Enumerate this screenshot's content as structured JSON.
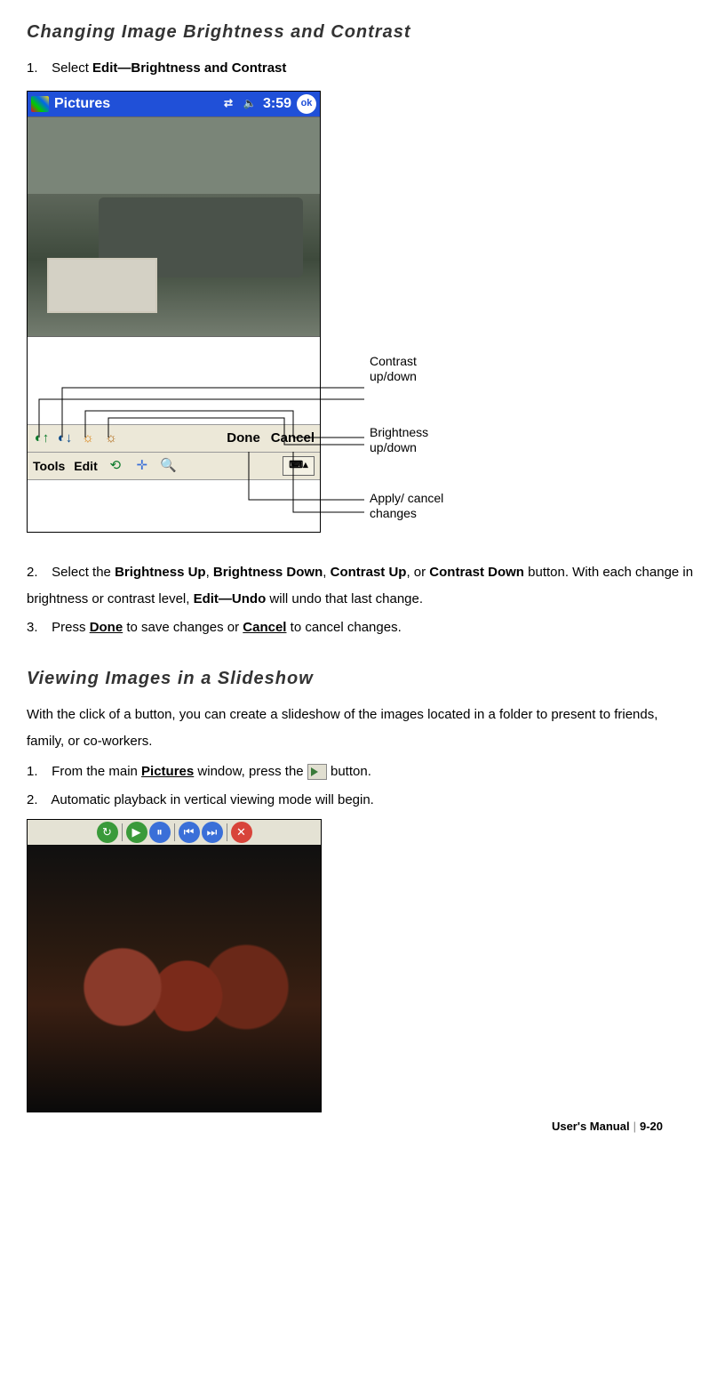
{
  "heading1": "Changing Image Brightness and Contrast",
  "step1": {
    "num": "1.",
    "pre": "Select ",
    "bold": "Edit—Brightness and Contrast"
  },
  "screenshot1": {
    "title": "Pictures",
    "time": "3:59",
    "ok": "ok",
    "done": "Done",
    "cancel": "Cancel",
    "tools": "Tools",
    "edit": "Edit",
    "callout_contrast": "Contrast up/down",
    "callout_brightness": "Brightness up/down",
    "callout_apply": "Apply/ cancel changes"
  },
  "step2": {
    "num": "2.",
    "t1": "Select the ",
    "b1": "Brightness Up",
    "t2": ", ",
    "b2": "Brightness Down",
    "t3": ", ",
    "b3": "Contrast Up",
    "t4": ", or ",
    "b4": "Contrast Down",
    "t5": " button.    With each change in brightness or contrast level, ",
    "b5": "Edit—Undo",
    "t6": " will undo that last change."
  },
  "step3": {
    "num": "3.",
    "t1": "Press ",
    "b1": "Done",
    "t2": " to save changes or ",
    "b2": "Cancel",
    "t3": " to cancel changes."
  },
  "heading2": "Viewing Images in a Slideshow",
  "slideshow_intro": "With the click of a button, you can create a slideshow of the images located in a folder to present to friends, family, or co-workers.",
  "slide_step1": {
    "num": "1.",
    "t1": "From the main ",
    "b1": "Pictures",
    "t2": " window, press the ",
    "t3": " button."
  },
  "slide_step2": {
    "num": "2.",
    "t1": "Automatic playback in vertical viewing mode will begin."
  },
  "footer": {
    "label": "User's Manual",
    "page": "9-20"
  }
}
